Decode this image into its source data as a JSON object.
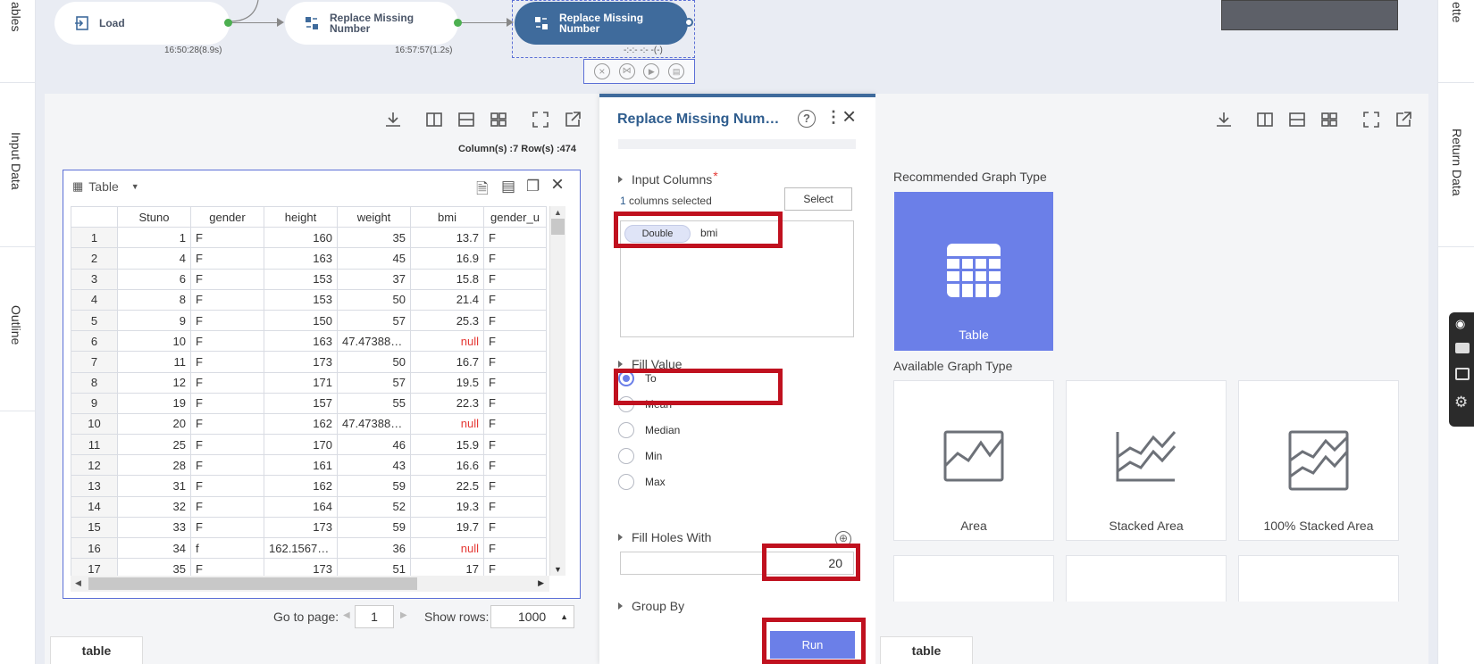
{
  "rails": {
    "left": [
      "ables",
      "Input Data",
      "Outline"
    ],
    "right": [
      "ette",
      "Return Data"
    ]
  },
  "workflow": {
    "nodes": [
      {
        "label": "Load",
        "time": "16:50:28(8.9s)"
      },
      {
        "label": "Replace Missing Number",
        "time": "16:57:57(1.2s)"
      },
      {
        "label": "Replace Missing Number",
        "time": "-:-:- -:- -(-)"
      }
    ]
  },
  "left_panel": {
    "summary": "Column(s) :7   Row(s) :474",
    "grid_title": "Table",
    "columns": [
      "",
      "Stuno",
      "gender",
      "height",
      "weight",
      "bmi",
      "gender_u"
    ],
    "rows": [
      [
        "1",
        "1",
        "F",
        "160",
        "35",
        "13.7",
        "F"
      ],
      [
        "2",
        "4",
        "F",
        "163",
        "45",
        "16.9",
        "F"
      ],
      [
        "3",
        "6",
        "F",
        "153",
        "37",
        "15.8",
        "F"
      ],
      [
        "4",
        "8",
        "F",
        "153",
        "50",
        "21.4",
        "F"
      ],
      [
        "5",
        "9",
        "F",
        "150",
        "57",
        "25.3",
        "F"
      ],
      [
        "6",
        "10",
        "F",
        "163",
        "47.47388…",
        "null",
        "F"
      ],
      [
        "7",
        "11",
        "F",
        "173",
        "50",
        "16.7",
        "F"
      ],
      [
        "8",
        "12",
        "F",
        "171",
        "57",
        "19.5",
        "F"
      ],
      [
        "9",
        "19",
        "F",
        "157",
        "55",
        "22.3",
        "F"
      ],
      [
        "10",
        "20",
        "F",
        "162",
        "47.47388…",
        "null",
        "F"
      ],
      [
        "11",
        "25",
        "F",
        "170",
        "46",
        "15.9",
        "F"
      ],
      [
        "12",
        "28",
        "F",
        "161",
        "43",
        "16.6",
        "F"
      ],
      [
        "13",
        "31",
        "F",
        "162",
        "59",
        "22.5",
        "F"
      ],
      [
        "14",
        "32",
        "F",
        "164",
        "52",
        "19.3",
        "F"
      ],
      [
        "15",
        "33",
        "F",
        "173",
        "59",
        "19.7",
        "F"
      ],
      [
        "16",
        "34",
        "f",
        "162.1567…",
        "36",
        "null",
        "F"
      ],
      [
        "17",
        "35",
        "F",
        "173",
        "51",
        "17",
        "F"
      ]
    ],
    "goto_label": "Go to page:",
    "page_value": "1",
    "show_rows_label": "Show rows:",
    "show_rows_value": "1000",
    "tab": "table"
  },
  "dialog": {
    "title": "Replace Missing Num…",
    "input_columns_label": "Input Columns",
    "required_mark": "*",
    "selected_count": "1",
    "selected_text": "columns selected",
    "select_button": "Select",
    "chip_type": "Double",
    "chip_name": "bmi",
    "fill_value_label": "Fill Value",
    "fill_options": [
      "To",
      "Mean",
      "Median",
      "Min",
      "Max"
    ],
    "fill_selected": "To",
    "fill_holes_label": "Fill Holes With",
    "fill_holes_value": "20",
    "group_by_label": "Group By",
    "run_button": "Run"
  },
  "right_panel": {
    "recommended_label": "Recommended Graph Type",
    "recommended": "Table",
    "available_label": "Available Graph Type",
    "available": [
      "Area",
      "Stacked Area",
      "100% Stacked Area"
    ],
    "tab": "table",
    "accent": "#6b7fe8"
  }
}
